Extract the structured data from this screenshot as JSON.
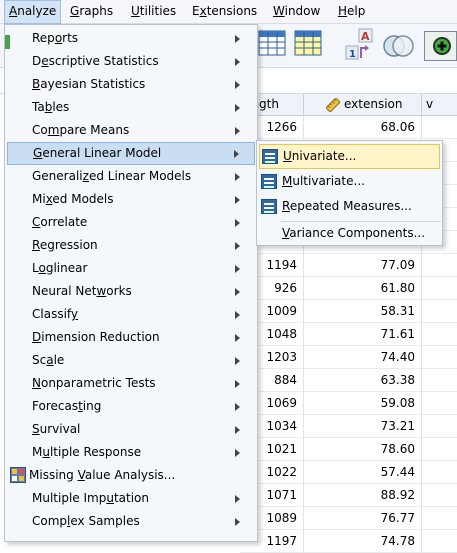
{
  "menubar": {
    "items": [
      {
        "label": "Analyze",
        "mnemonic": "A",
        "rest": "nalyze",
        "pre": ""
      },
      {
        "label": "Graphs",
        "pre": "",
        "mnemonic": "G",
        "rest": "raphs"
      },
      {
        "label": "Utilities",
        "pre": "",
        "mnemonic": "U",
        "rest": "tilities"
      },
      {
        "label": "Extensions",
        "pre": "E",
        "mnemonic": "x",
        "rest": "tensions"
      },
      {
        "label": "Window",
        "pre": "",
        "mnemonic": "W",
        "rest": "indow"
      },
      {
        "label": "Help",
        "pre": "",
        "mnemonic": "H",
        "rest": "elp"
      }
    ]
  },
  "analyze_menu": {
    "items": [
      {
        "pre": "Rep",
        "mn": "o",
        "post": "rts",
        "submenu": true
      },
      {
        "pre": "D",
        "mn": "e",
        "post": "scriptive Statistics",
        "submenu": true
      },
      {
        "pre": "",
        "mn": "B",
        "post": "ayesian Statistics",
        "submenu": true
      },
      {
        "pre": "Ta",
        "mn": "b",
        "post": "les",
        "submenu": true
      },
      {
        "pre": "Co",
        "mn": "m",
        "post": "pare Means",
        "submenu": true
      },
      {
        "pre": "",
        "mn": "G",
        "post": "eneral Linear Model",
        "submenu": true
      },
      {
        "pre": "Generali",
        "mn": "z",
        "post": "ed Linear Models",
        "submenu": true
      },
      {
        "pre": "Mi",
        "mn": "x",
        "post": "ed Models",
        "submenu": true
      },
      {
        "pre": "",
        "mn": "C",
        "post": "orrelate",
        "submenu": true
      },
      {
        "pre": "",
        "mn": "R",
        "post": "egression",
        "submenu": true
      },
      {
        "pre": "L",
        "mn": "o",
        "post": "glinear",
        "submenu": true
      },
      {
        "pre": "Neural Net",
        "mn": "w",
        "post": "orks",
        "submenu": true
      },
      {
        "pre": "Classif",
        "mn": "y",
        "post": "",
        "submenu": true
      },
      {
        "pre": "",
        "mn": "D",
        "post": "imension Reduction",
        "submenu": true
      },
      {
        "pre": "Sc",
        "mn": "a",
        "post": "le",
        "submenu": true
      },
      {
        "pre": "",
        "mn": "N",
        "post": "onparametric Tests",
        "submenu": true
      },
      {
        "pre": "Forecas",
        "mn": "t",
        "post": "ing",
        "submenu": true
      },
      {
        "pre": "",
        "mn": "S",
        "post": "urvival",
        "submenu": true
      },
      {
        "pre": "M",
        "mn": "u",
        "post": "ltiple Response",
        "submenu": true
      },
      {
        "pre": "Missing ",
        "mn": "V",
        "post": "alue Analysis...",
        "submenu": false,
        "icon": true
      },
      {
        "pre": "Multiple Imp",
        "mn": "u",
        "post": "tation",
        "submenu": true
      },
      {
        "pre": "Comp",
        "mn": "l",
        "post": "ex Samples",
        "submenu": true
      }
    ]
  },
  "glm_submenu": {
    "items": [
      {
        "pre": "",
        "mn": "U",
        "post": "nivariate...",
        "icon": true
      },
      {
        "pre": "",
        "mn": "M",
        "post": "ultivariate...",
        "icon": true
      },
      {
        "pre": "",
        "mn": "R",
        "post": "epeated Measures...",
        "icon": true
      },
      {
        "pre": "",
        "mn": "V",
        "post": "ariance Components...",
        "icon": false
      }
    ]
  },
  "grid": {
    "col_length_header": "ngth",
    "col_extension_header": "extension",
    "col_next_header": "v",
    "rows": [
      {
        "length": "1266",
        "extension": "68.06"
      },
      {
        "length": "",
        "extension": ""
      },
      {
        "length": "",
        "extension": ""
      },
      {
        "length": "",
        "extension": ""
      },
      {
        "length": "",
        "extension": ""
      },
      {
        "length": "",
        "extension": ""
      },
      {
        "length": "1194",
        "extension": "77.09"
      },
      {
        "length": "926",
        "extension": "61.80"
      },
      {
        "length": "1009",
        "extension": "58.31"
      },
      {
        "length": "1048",
        "extension": "71.61"
      },
      {
        "length": "1203",
        "extension": "74.40"
      },
      {
        "length": "884",
        "extension": "63.38"
      },
      {
        "length": "1069",
        "extension": "59.08"
      },
      {
        "length": "1034",
        "extension": "73.21"
      },
      {
        "length": "1021",
        "extension": "78.60"
      },
      {
        "length": "1022",
        "extension": "57.44"
      },
      {
        "length": "1071",
        "extension": "88.92"
      },
      {
        "length": "1089",
        "extension": "76.77"
      },
      {
        "length": "1197",
        "extension": "74.78"
      }
    ]
  },
  "colors": {
    "menu_bg": "#f5f8fb",
    "highlight": "#c9def3",
    "submenu_highlight": "#fff5c8",
    "submenu_highlight_border": "#e8c84a"
  }
}
